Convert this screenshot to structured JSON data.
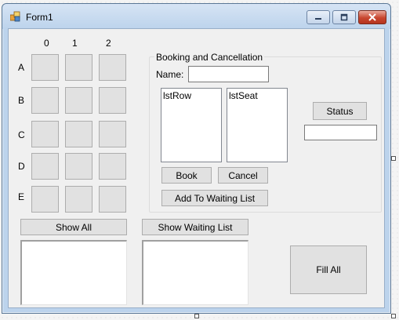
{
  "window": {
    "title": "Form1"
  },
  "seat_grid": {
    "columns": [
      "0",
      "1",
      "2"
    ],
    "rows": [
      "A",
      "B",
      "C",
      "D",
      "E"
    ]
  },
  "booking_group": {
    "caption": "Booking and Cancellation",
    "name_label": "Name:",
    "name_value": "",
    "row_list_items": [
      "lstRow"
    ],
    "seat_list_items": [
      "lstSeat"
    ],
    "book_label": "Book",
    "cancel_label": "Cancel",
    "waiting_label": "Add To Waiting List"
  },
  "status": {
    "button_label": "Status",
    "value": ""
  },
  "bottom": {
    "show_all_label": "Show All",
    "show_waiting_label": "Show Waiting List",
    "fill_all_label": "Fill All"
  }
}
